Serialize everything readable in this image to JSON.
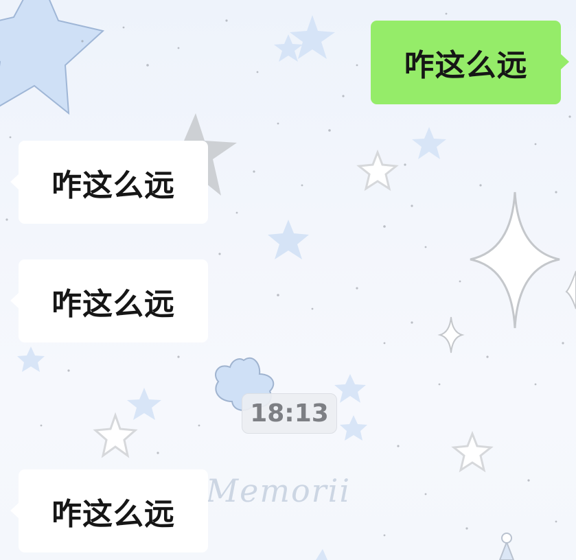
{
  "chat": {
    "messages": [
      {
        "direction": "outgoing",
        "text": "咋这么远"
      },
      {
        "direction": "incoming",
        "text": "咋这么远"
      },
      {
        "direction": "incoming",
        "text": "咋这么远"
      },
      {
        "direction": "incoming",
        "text": "咋这么远"
      }
    ],
    "timestamp": "18:13",
    "wallpaper_signature": "Memorii"
  },
  "colors": {
    "outgoing_bubble": "#95ec69",
    "incoming_bubble": "#ffffff",
    "timestamp_text": "#7d7f84",
    "background": "#f1f5fc"
  }
}
